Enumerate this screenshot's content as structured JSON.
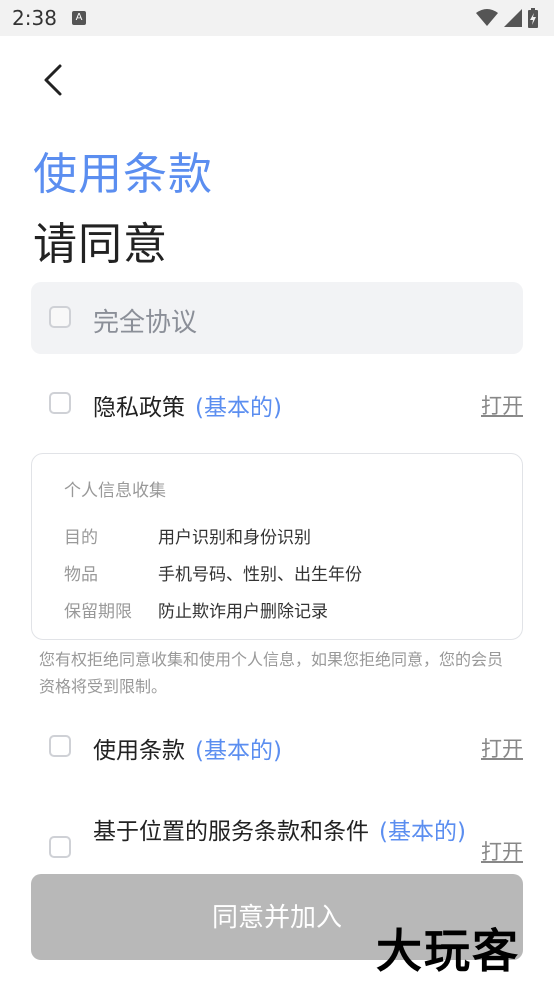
{
  "status_bar": {
    "time": "2:38",
    "notification_icon": "A"
  },
  "header": {
    "title": "使用条款",
    "subtitle": "请同意"
  },
  "agree_all": {
    "label": "完全协议"
  },
  "items": [
    {
      "label": "隐私政策",
      "tag": "(基本的)",
      "open": "打开"
    },
    {
      "label": "使用条款",
      "tag": "(基本的)",
      "open": "打开"
    },
    {
      "label": "基于位置的服务条款和条件",
      "tag": "(基本的)",
      "open": "打开"
    }
  ],
  "personal_info": {
    "heading": "个人信息收集",
    "rows": [
      {
        "key": "目的",
        "value": "用户识别和身份识别"
      },
      {
        "key": "物品",
        "value": "手机号码、性别、出生年份"
      },
      {
        "key": "保留期限",
        "value": "防止欺诈用户删除记录"
      }
    ]
  },
  "note": "您有权拒绝同意收集和使用个人信息，如果您拒绝同意，您的会员资格将受到限制。",
  "agree_button": "同意并加入",
  "watermark": "大玩客",
  "colors": {
    "accent": "#5b8ef0",
    "button_disabled": "#b8b8b8"
  }
}
